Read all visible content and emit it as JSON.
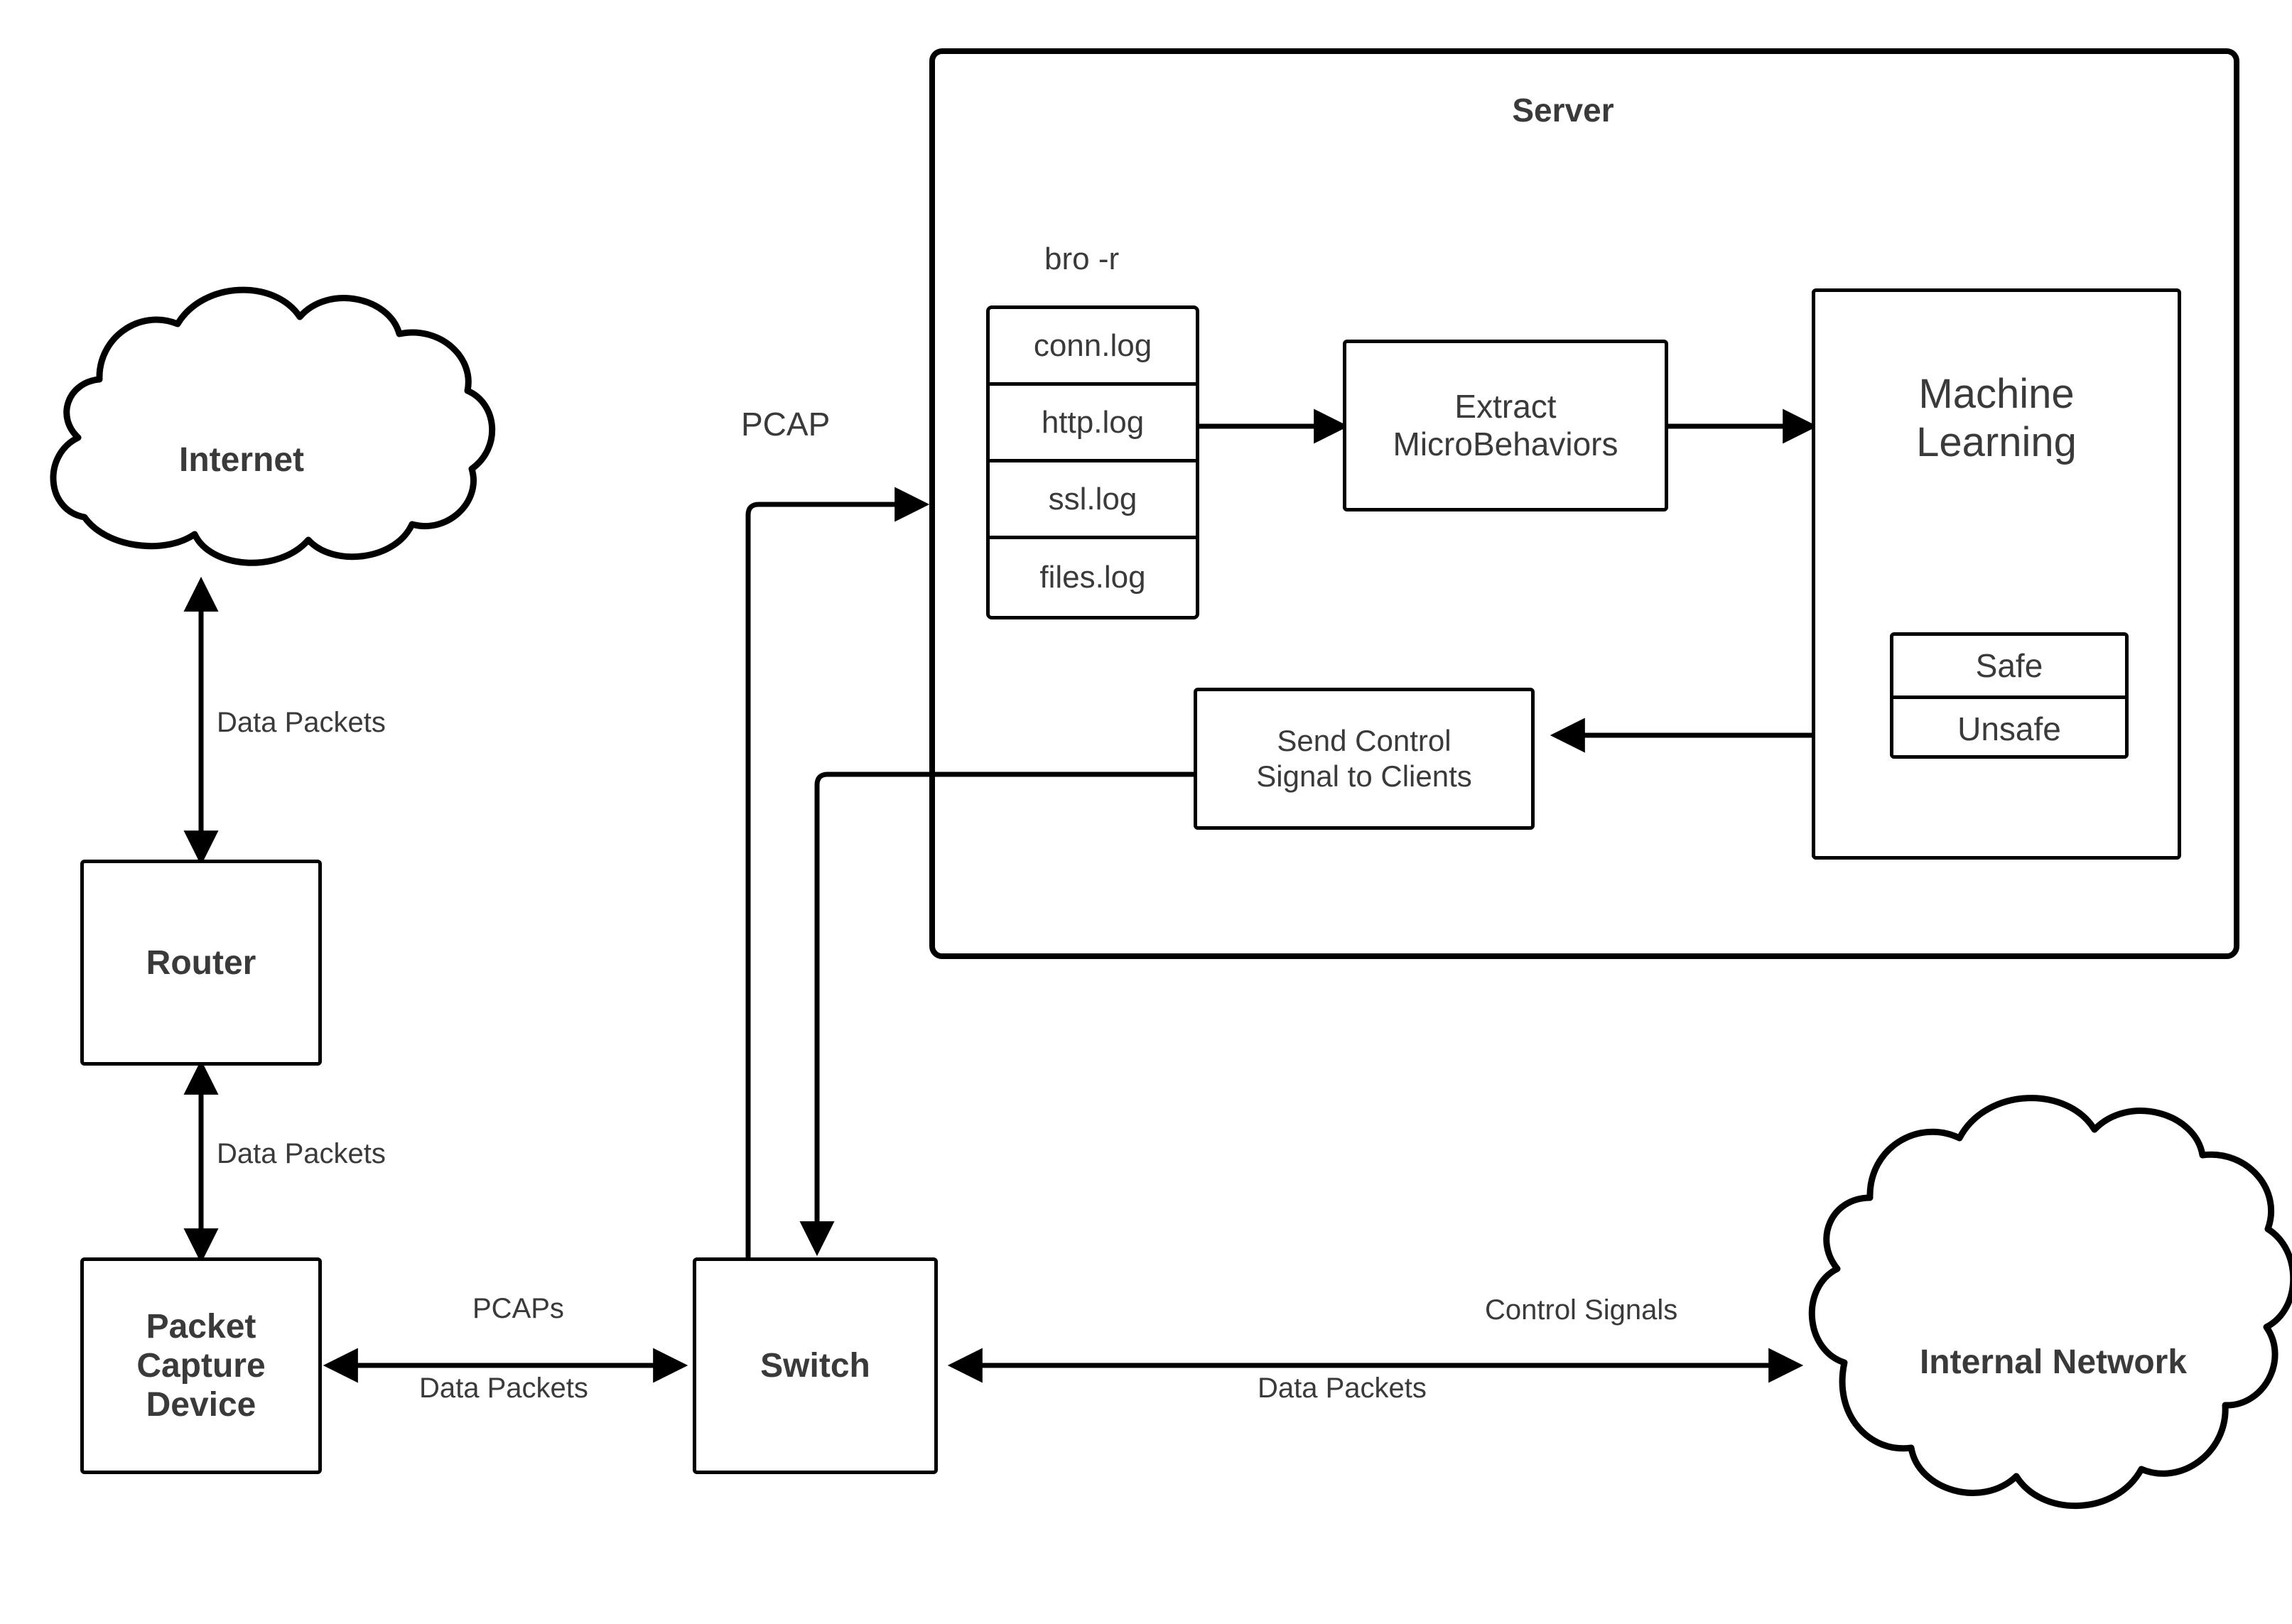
{
  "diagram": {
    "title_server": "Server",
    "nodes": {
      "internet": "Internet",
      "router": "Router",
      "packet_capture_device": "Packet\nCapture\nDevice",
      "packet_capture_device_lines": [
        "Packet",
        "Capture",
        "Device"
      ],
      "switch": "Switch",
      "internal_network": "Internal Network",
      "extract": "Extract\nMicroBehaviors",
      "extract_lines": [
        "Extract",
        "MicroBehaviors"
      ],
      "machine_learning": "Machine\nLearning",
      "machine_learning_lines": [
        "Machine",
        "Learning"
      ],
      "send_control": "Send Control\nSignal to Clients",
      "send_control_lines": [
        "Send Control",
        "Signal to Clients"
      ]
    },
    "bro_command": "bro -r",
    "logs": [
      "conn.log",
      "http.log",
      "ssl.log",
      "files.log"
    ],
    "verdicts": [
      "Safe",
      "Unsafe"
    ],
    "edge_labels": {
      "internet_router": "Data Packets",
      "router_pcd": "Data Packets",
      "pcd_switch_top": "PCAPs",
      "pcd_switch_bottom": "Data Packets",
      "switch_server_pcap": "PCAP",
      "switch_internal_top": "Control Signals",
      "switch_internal_bottom": "Data Packets"
    },
    "colors": {
      "stroke": "#000000",
      "text": "#3a3a3a",
      "background": "#ffffff"
    }
  }
}
